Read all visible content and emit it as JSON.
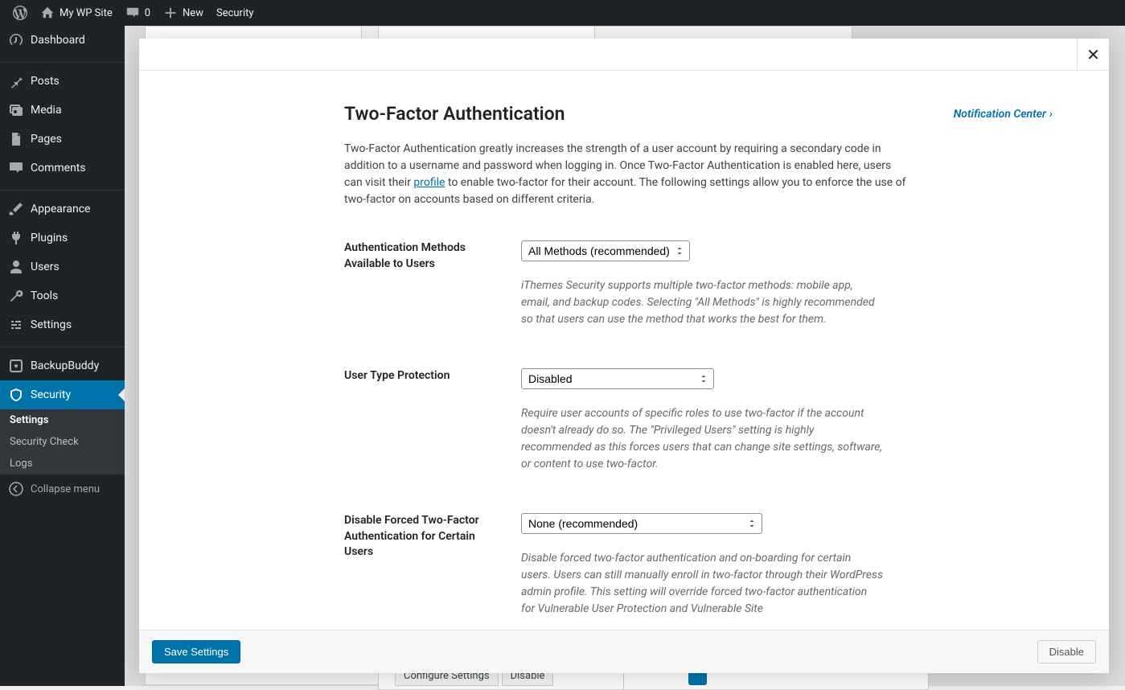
{
  "adminbar": {
    "site_name": "My WP Site",
    "comments_count": "0",
    "new_label": "New",
    "security_label": "Security"
  },
  "sidemenu": {
    "items": [
      {
        "label": "Dashboard",
        "icon": "dashboard"
      },
      {
        "label": "Posts",
        "icon": "pin"
      },
      {
        "label": "Media",
        "icon": "media"
      },
      {
        "label": "Pages",
        "icon": "page"
      },
      {
        "label": "Comments",
        "icon": "comment"
      },
      {
        "label": "Appearance",
        "icon": "brush"
      },
      {
        "label": "Plugins",
        "icon": "plugin"
      },
      {
        "label": "Users",
        "icon": "users"
      },
      {
        "label": "Tools",
        "icon": "tools"
      },
      {
        "label": "Settings",
        "icon": "settings"
      },
      {
        "label": "BackupBuddy",
        "icon": "backup"
      },
      {
        "label": "Security",
        "icon": "shield"
      }
    ],
    "submenu": [
      {
        "label": "Settings",
        "current": true
      },
      {
        "label": "Security Check",
        "current": false
      },
      {
        "label": "Logs",
        "current": false
      }
    ],
    "collapse_label": "Collapse menu"
  },
  "bg": {
    "configure": "Configure Settings",
    "disable": "Disable"
  },
  "modal": {
    "title": "Two-Factor Authentication",
    "notification_link": "Notification Center",
    "description_1": "Two-Factor Authentication greatly increases the strength of a user account by requiring a secondary code in addition to a username and password when logging in. Once Two-Factor Authentication is enabled here, users can visit their ",
    "description_link": "profile",
    "description_2": " to enable two-factor for their account. The following settings allow you to enforce the use of two-factor on accounts based on different criteria.",
    "fields": {
      "auth_methods": {
        "label": "Authentication Methods Available to Users",
        "value": "All Methods (recommended)",
        "help": "iThemes Security supports multiple two-factor methods: mobile app, email, and backup codes. Selecting \"All Methods\" is highly recommended so that users can use the method that works the best for them."
      },
      "user_type": {
        "label": "User Type Protection",
        "value": "Disabled",
        "help": "Require user accounts of specific roles to use two-factor if the account doesn't already do so. The \"Privileged Users\" setting is highly recommended as this forces users that can change site settings, software, or content to use two-factor."
      },
      "disable_forced": {
        "label": "Disable Forced Two-Factor Authentication for Certain Users",
        "value": "None (recommended)",
        "help": "Disable forced two-factor authentication and on-boarding for certain users. Users can still manually enroll in two-factor through their WordPress admin profile. This setting will override forced two-factor authentication for Vulnerable User Protection and Vulnerable Site"
      }
    },
    "save_label": "Save Settings",
    "disable_label": "Disable"
  }
}
